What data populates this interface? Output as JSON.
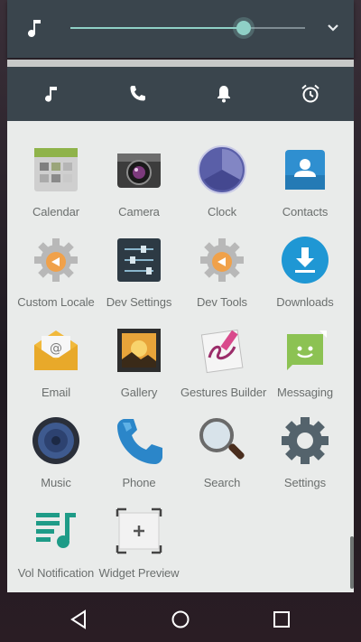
{
  "volume_panel": {
    "level": 0.74,
    "accent_color": "#8fd0c6",
    "icons": [
      "music-note-icon",
      "chevron-down-icon"
    ]
  },
  "streams": [
    {
      "icon": "music-note-icon"
    },
    {
      "icon": "phone-icon"
    },
    {
      "icon": "bell-icon"
    },
    {
      "icon": "alarm-icon"
    }
  ],
  "apps": [
    {
      "label": "Calendar",
      "icon": "calendar-icon"
    },
    {
      "label": "Camera",
      "icon": "camera-icon"
    },
    {
      "label": "Clock",
      "icon": "clock-icon"
    },
    {
      "label": "Contacts",
      "icon": "contacts-icon"
    },
    {
      "label": "Custom Locale",
      "icon": "gear-icon"
    },
    {
      "label": "Dev Settings",
      "icon": "sliders-icon"
    },
    {
      "label": "Dev Tools",
      "icon": "gear-icon"
    },
    {
      "label": "Downloads",
      "icon": "download-icon"
    },
    {
      "label": "Email",
      "icon": "email-icon"
    },
    {
      "label": "Gallery",
      "icon": "gallery-icon"
    },
    {
      "label": "Gestures Builder",
      "icon": "gestures-icon"
    },
    {
      "label": "Messaging",
      "icon": "messaging-icon"
    },
    {
      "label": "Music",
      "icon": "speaker-icon"
    },
    {
      "label": "Phone",
      "icon": "phone-icon"
    },
    {
      "label": "Search",
      "icon": "magnifier-icon"
    },
    {
      "label": "Settings",
      "icon": "settings-gear-icon"
    },
    {
      "label": "Vol Notification",
      "icon": "music-notes-icon"
    },
    {
      "label": "Widget Preview",
      "icon": "widget-preview-icon"
    }
  ],
  "navbar": {
    "buttons": [
      "back-icon",
      "home-icon",
      "recents-icon"
    ]
  }
}
